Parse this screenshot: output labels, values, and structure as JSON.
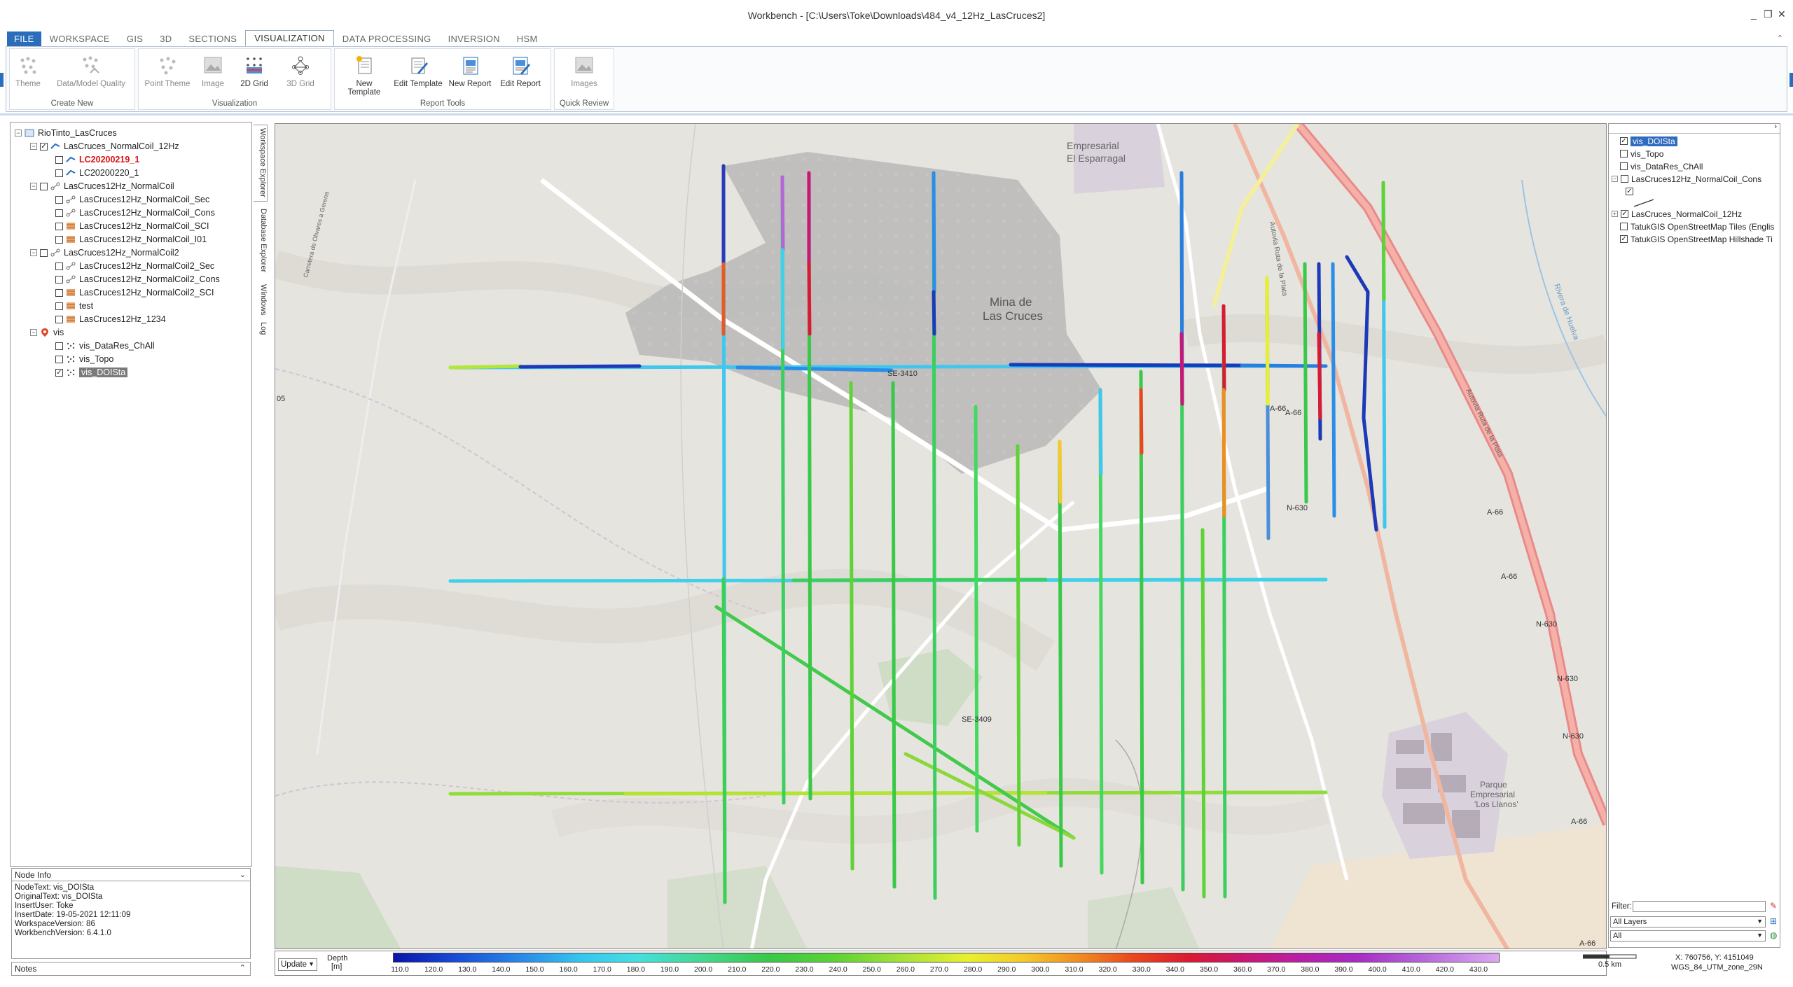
{
  "window": {
    "title": "Workbench - [C:\\Users\\Toke\\Downloads\\484_v4_12Hz_LasCruces2]",
    "controls": [
      "_",
      "❐",
      "✕"
    ]
  },
  "ribbon": {
    "tabs": [
      "FILE",
      "WORKSPACE",
      "GIS",
      "3D",
      "SECTIONS",
      "VISUALIZATION",
      "DATA PROCESSING",
      "INVERSION",
      "HSM"
    ],
    "active_tab": "VISUALIZATION",
    "groups": [
      {
        "label": "Create New",
        "buttons": [
          "Theme",
          "Data/Model Quality"
        ]
      },
      {
        "label": "Visualization",
        "buttons": [
          "Point Theme",
          "Image",
          "2D Grid",
          "3D Grid"
        ]
      },
      {
        "label": "Report Tools",
        "buttons": [
          "New Template",
          "Edit Template",
          "New Report",
          "Edit Report"
        ]
      },
      {
        "label": "Quick Review",
        "buttons": [
          "Images"
        ]
      }
    ]
  },
  "side_tabs": [
    "Workspace Explorer",
    "Database Explorer",
    "Windows",
    "Log"
  ],
  "tree": {
    "root": "RioTinto_LasCruces",
    "n1": "LasCruces_NormalCoil_12Hz",
    "n1a": "LC20200219_1",
    "n1b": "LC20200220_1",
    "n2": "LasCruces12Hz_NormalCoil",
    "n2a": "LasCruces12Hz_NormalCoil_Sec",
    "n2b": "LasCruces12Hz_NormalCoil_Cons",
    "n2c": "LasCruces12Hz_NormalCoil_SCI",
    "n2d": "LasCruces12Hz_NormalCoil_I01",
    "n3": "LasCruces12Hz_NormalCoil2",
    "n3a": "LasCruces12Hz_NormalCoil2_Sec",
    "n3b": "LasCruces12Hz_NormalCoil2_Cons",
    "n3c": "LasCruces12Hz_NormalCoil2_SCI",
    "n3d": "test",
    "n3e": "LasCruces12Hz_1234",
    "n4": "vis",
    "n4a": "vis_DataRes_ChAll",
    "n4b": "vis_Topo",
    "n4c": "vis_DOISta"
  },
  "node_info": {
    "header": "Node Info",
    "lines": [
      "NodeText:  vis_DOISta",
      "OriginalText:  vis_DOISta",
      "InsertUser:  Toke",
      "InsertDate:  19-05-2021 12:11:09",
      "WorkspaceVersion:  86",
      "WorkbenchVersion:  6.4.1.0"
    ]
  },
  "notes_label": "Notes",
  "map_labels": {
    "empresarial": "Empresarial",
    "esparragal": "El Esparragal",
    "mina1": "Mina de",
    "mina2": "Las Cruces",
    "se3410": "SE-3410",
    "se3409": "SE-3409",
    "a66a": "A-66",
    "a66b": "A-66",
    "a66c": "A-66",
    "a66d": "A-66",
    "a66e": "A-66",
    "n630a": "N-630",
    "n630b": "N-630",
    "n630c": "N-630",
    "n630d": "N-630",
    "a66f": "A-66",
    "autovia1": "Autovía Ruta de la Plata",
    "autovia2": "Autovía Ruta de la Plata",
    "parque1": "Parque",
    "parque2": "Empresarial",
    "parque3": "'Los Llanos'",
    "left05": "05",
    "carretera": "Carretera de Olivares a Gerena",
    "ribera": "Rivera de Huelva"
  },
  "legend": {
    "update": "Update",
    "depth": "Depth",
    "unit": "[m]",
    "ticks": [
      "110.0",
      "120.0",
      "130.0",
      "140.0",
      "150.0",
      "160.0",
      "170.0",
      "180.0",
      "190.0",
      "200.0",
      "210.0",
      "220.0",
      "230.0",
      "240.0",
      "250.0",
      "260.0",
      "270.0",
      "280.0",
      "290.0",
      "300.0",
      "310.0",
      "320.0",
      "330.0",
      "340.0",
      "350.0",
      "360.0",
      "370.0",
      "380.0",
      "390.0",
      "400.0",
      "410.0",
      "420.0",
      "430.0"
    ]
  },
  "layers": {
    "l1": "vis_DOISta",
    "l2": "vis_Topo",
    "l3": "vis_DataRes_ChAll",
    "l4": "LasCruces12Hz_NormalCoil_Cons",
    "l5": "LasCruces_NormalCoil_12Hz",
    "l6": "TatukGIS OpenStreetMap Tiles (Englis",
    "l7": "TatukGIS OpenStreetMap Hillshade Ti"
  },
  "filter": {
    "label": "Filter:",
    "all_layers": "All Layers",
    "all": "All"
  },
  "status": {
    "coords": "X: 760756, Y: 4151049",
    "crs": "WGS_84_UTM_zone_29N",
    "scale": "0.5 km"
  }
}
